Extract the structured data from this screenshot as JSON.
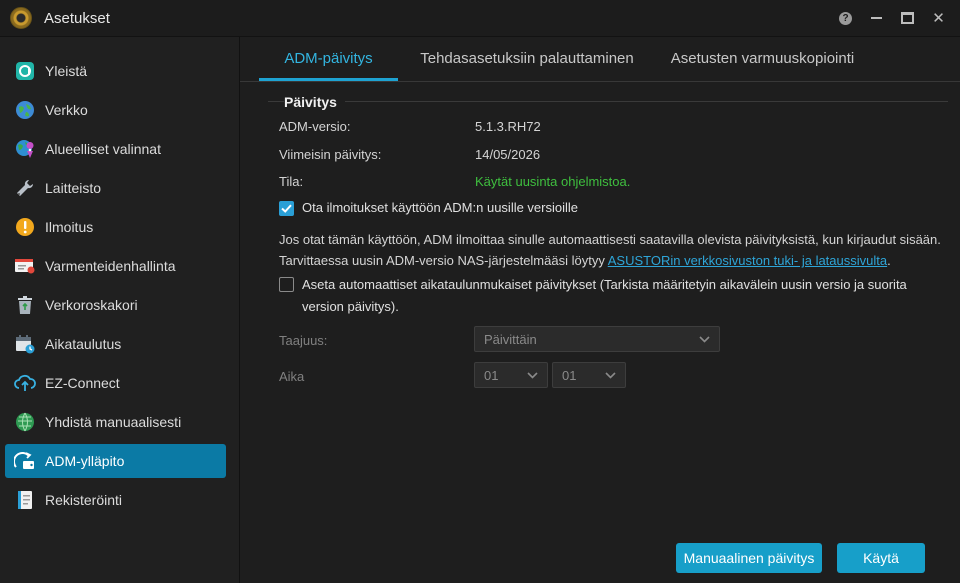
{
  "window": {
    "title": "Asetukset",
    "help_glyph": "?",
    "close_glyph": "✕"
  },
  "sidebar": {
    "items": [
      {
        "label": "Yleistä",
        "icon": "general-icon"
      },
      {
        "label": "Verkko",
        "icon": "network-globe-icon"
      },
      {
        "label": "Alueelliset valinnat",
        "icon": "regional-globe-pin-icon"
      },
      {
        "label": "Laitteisto",
        "icon": "hardware-wrench-icon"
      },
      {
        "label": "Ilmoitus",
        "icon": "notification-exclamation-icon"
      },
      {
        "label": "Varmenteidenhallinta",
        "icon": "certificate-icon"
      },
      {
        "label": "Verkoroskakori",
        "icon": "recycle-bin-icon"
      },
      {
        "label": "Aikataulutus",
        "icon": "calendar-clock-icon"
      },
      {
        "label": "EZ-Connect",
        "icon": "cloud-connect-icon"
      },
      {
        "label": "Yhdistä manuaalisesti",
        "icon": "connect-globe-icon"
      },
      {
        "label": "ADM-ylläpito",
        "icon": "maintenance-icon",
        "active": true
      },
      {
        "label": "Rekisteröinti",
        "icon": "registration-icon"
      }
    ]
  },
  "tabs": [
    {
      "label": "ADM-päivitys",
      "active": true
    },
    {
      "label": "Tehdasasetuksiin palauttaminen"
    },
    {
      "label": "Asetusten varmuuskopiointi"
    }
  ],
  "update": {
    "section_title": "Päivitys",
    "version_label": "ADM-versio:",
    "version_value": "5.1.3.RH72",
    "latest_label": "Viimeisin päivitys:",
    "latest_value": "14/05/2026",
    "status_label": "Tila:",
    "status_value": "Käytät uusinta ohjelmistoa.",
    "notify_label": "Ota ilmoitukset käyttöön ADM:n uusille versioille",
    "notify_checked": true,
    "description_part1": "Jos otat tämän käyttöön, ADM ilmoittaa sinulle automaattisesti saatavilla olevista päivityksistä, kun kirjaudut sisään. Tarvittaessa uusin ADM-versio NAS-järjestelmääsi löytyy ",
    "description_link": "ASUSTORin verkkosivuston tuki- ja lataussivulta",
    "description_part2": ".",
    "auto_label": "Aseta automaattiset aikataulunmukaiset päivitykset (Tarkista määritetyin aikavälein uusin versio ja suorita version päivitys).",
    "auto_checked": false,
    "frequency_label": "Taajuus:",
    "frequency_value": "Päivittäin",
    "time_label": "Aika",
    "hour_value": "01",
    "minute_value": "01"
  },
  "buttons": {
    "manual_update": "Manuaalinen päivitys",
    "apply": "Käytä"
  },
  "colors": {
    "accent": "#1ea3d2",
    "active_nav": "#0b7aa5",
    "status_ok": "#3fbf3f",
    "link": "#2ea5d8"
  }
}
